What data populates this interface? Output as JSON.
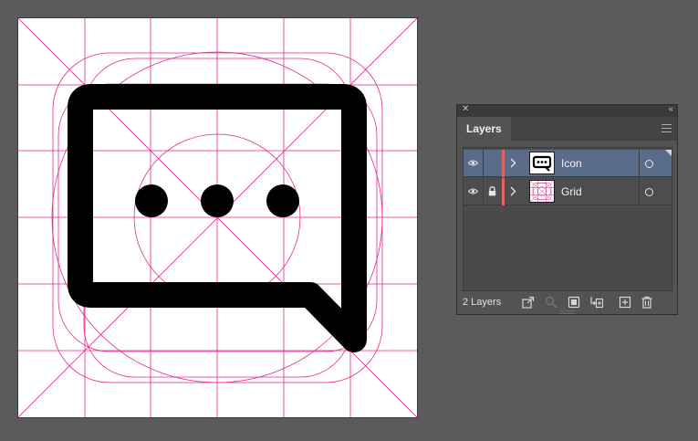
{
  "canvas": {
    "artwork": "speech-bubble-with-three-dots",
    "guide_color": "#e3278f",
    "artwork_color": "#000000",
    "artboard_color": "#ffffff"
  },
  "layers_panel": {
    "tab_label": "Layers",
    "layer_count_label": "2 Layers",
    "layer_color_bar": "#e06464",
    "selected_row_color": "#596c8a",
    "layers": [
      {
        "name": "Icon",
        "visible": true,
        "locked": false,
        "selected": true,
        "expanded": false
      },
      {
        "name": "Grid",
        "visible": true,
        "locked": true,
        "selected": false,
        "expanded": false
      }
    ],
    "footer_icons": [
      "export-icon",
      "search-icon",
      "clipping-mask-icon",
      "sublayer-icon",
      "new-layer-icon",
      "trash-icon"
    ]
  }
}
